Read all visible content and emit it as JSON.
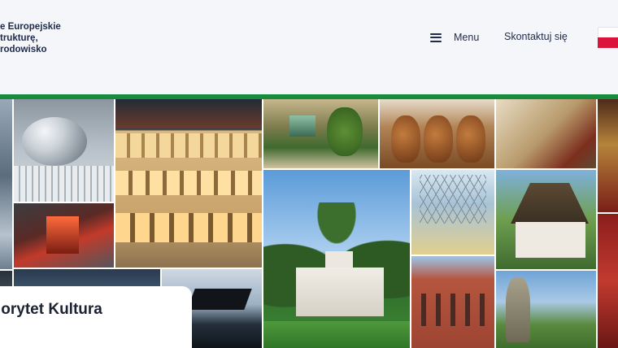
{
  "header": {
    "logo_lines": [
      "e Europejskie",
      "trukturę,",
      "rodowisko"
    ],
    "menu_label": "Menu",
    "contact_label": "Skontaktuj się",
    "language_flag": "flag-poland-icon"
  },
  "gallery": {
    "caption_title": "iorytet Kultura"
  },
  "colors": {
    "accent_green": "#178a3e",
    "header_bg": "#f5f6fa",
    "text_dark": "#1e2a4a"
  }
}
